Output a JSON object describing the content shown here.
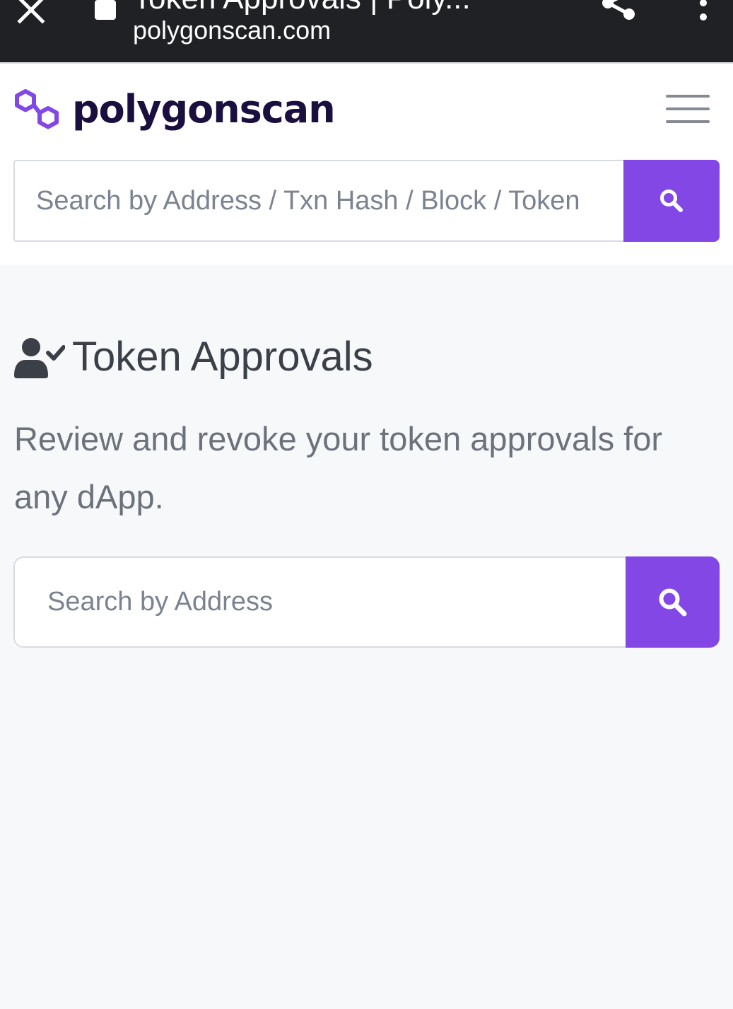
{
  "browser": {
    "page_title": "Token Approvals | Poly...",
    "url": "polygonscan.com"
  },
  "header": {
    "logo_text": "polygonscan",
    "search": {
      "placeholder": "Search by Address / Txn Hash / Block / Token"
    }
  },
  "main": {
    "title": "Token Approvals",
    "description": "Review and revoke your token approvals for any dApp.",
    "search": {
      "placeholder": "Search by Address"
    }
  },
  "colors": {
    "accent": "#8247e5",
    "browser_bar": "#202124",
    "logo_text": "#1b0f3f",
    "page_background": "#f7f8fa"
  },
  "icons": {
    "browser_close": "close-icon",
    "browser_lock": "lock-icon",
    "browser_share": "share-icon",
    "browser_menu": "more-vertical-icon",
    "logo": "polygon-logo-icon",
    "nav_menu": "hamburger-menu-icon",
    "search": "search-icon",
    "title": "user-check-icon"
  }
}
